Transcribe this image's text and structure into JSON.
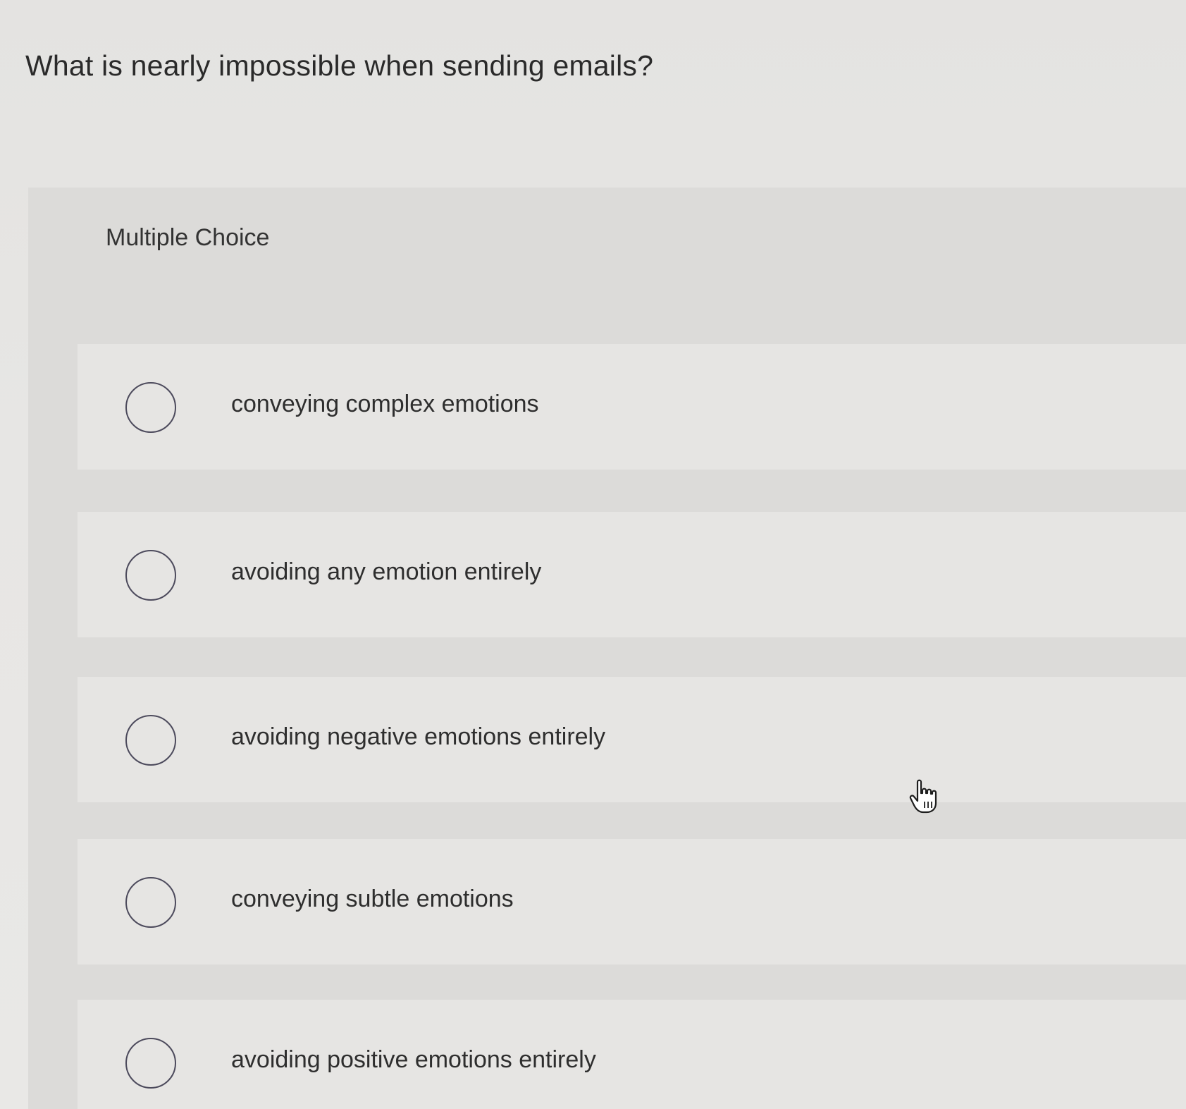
{
  "question": {
    "text": "What is nearly impossible when sending emails?"
  },
  "answer_section": {
    "type_label": "Multiple Choice",
    "options": [
      {
        "label": "conveying complex emotions",
        "selected": false
      },
      {
        "label": "avoiding any emotion entirely",
        "selected": false
      },
      {
        "label": "avoiding negative emotions entirely",
        "selected": false
      },
      {
        "label": "conveying subtle emotions",
        "selected": false
      },
      {
        "label": "avoiding positive emotions entirely",
        "selected": false
      }
    ]
  },
  "cursor": {
    "icon": "hand-pointer-icon"
  }
}
